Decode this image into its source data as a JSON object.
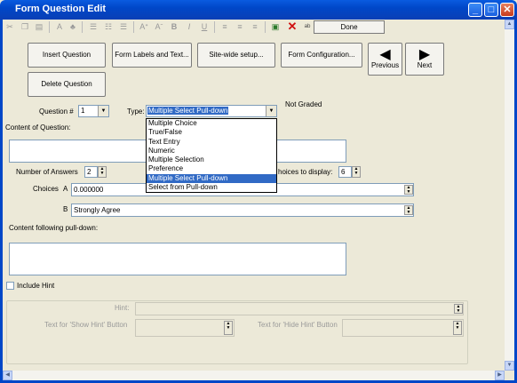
{
  "window": {
    "title": "Form Question Edit",
    "min": "_",
    "max": "□",
    "close": "✕"
  },
  "toolbar": {
    "done_label": "Done"
  },
  "buttons": {
    "insert": "Insert Question",
    "labels": "Form Labels and Text...",
    "sitewide": "Site-wide setup...",
    "config": "Form Configuration...",
    "previous": "Previous",
    "next": "Next",
    "delete": "Delete Question"
  },
  "question": {
    "number_label": "Question #",
    "number_value": "1",
    "type_label": "Type:",
    "type_value": "Multiple Select Pull-down",
    "graded_status": "Not Graded",
    "content_label": "Content of Question:"
  },
  "type_options": [
    "Multiple Choice",
    "True/False",
    "Text Entry",
    "Numeric",
    "Multiple Selection",
    "Preference",
    "Multiple Select Pull-down",
    "Select from Pull-down"
  ],
  "answers": {
    "count_label": "Number of Answers",
    "count_value": "2",
    "display_label": "hoices to display:",
    "display_value": "6",
    "choices_label": "Choices",
    "choice_a_letter": "A",
    "choice_a_value": "0.000000",
    "choice_b_letter": "B",
    "choice_b_value": "Strongly Agree"
  },
  "following_label": "Content following pull-down:",
  "hint": {
    "include_label": "Include Hint",
    "hint_label": "Hint:",
    "show_label": "Text for 'Show Hint' Button",
    "hide_label": "Text for 'Hide Hint' Button"
  }
}
